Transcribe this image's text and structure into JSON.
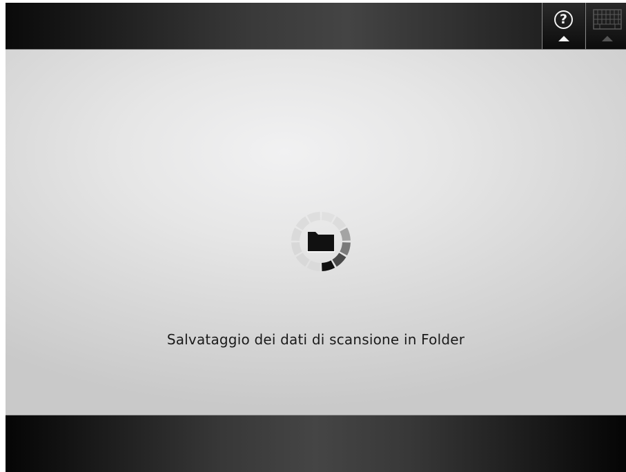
{
  "header": {
    "help_button": {
      "icon": "help-icon",
      "glyph": "?",
      "indicator": "up-arrow-icon"
    },
    "keyboard_button": {
      "icon": "keyboard-icon",
      "indicator": "up-arrow-icon",
      "state": "disabled"
    }
  },
  "main": {
    "progress_icon": "folder-icon",
    "spinner": "loading-spinner",
    "status_message": "Salvataggio dei dati di scansione in Folder"
  },
  "colors": {
    "panel_background": "#e6e6e6",
    "bar_background": "#2a2a2a",
    "text": "#1a1a1a",
    "icon_light": "#f4f4f4"
  }
}
